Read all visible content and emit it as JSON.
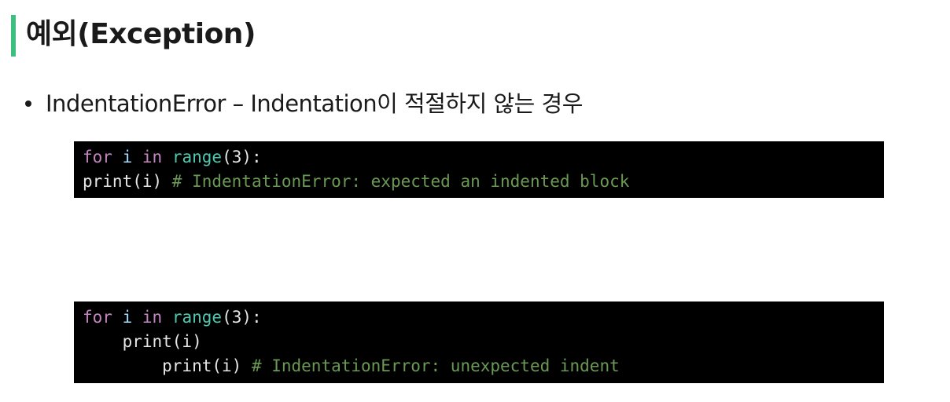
{
  "slide": {
    "title": "예외(Exception)",
    "bullet": "IndentationError – Indentation이 적절하지 않는 경우"
  },
  "colors": {
    "accent": "#3fbf7f",
    "code_bg": "#000000",
    "keyword": "#c586c0",
    "variable": "#9cdcfe",
    "function": "#4ec9b0",
    "comment": "#6a9955",
    "plain": "#e6e6e6"
  },
  "code_blocks": [
    {
      "lines": [
        [
          {
            "t": "for",
            "c": "kw"
          },
          {
            "t": " ",
            "c": "pl"
          },
          {
            "t": "i",
            "c": "var"
          },
          {
            "t": " ",
            "c": "pl"
          },
          {
            "t": "in",
            "c": "kw"
          },
          {
            "t": " ",
            "c": "pl"
          },
          {
            "t": "range",
            "c": "fn"
          },
          {
            "t": "(3):",
            "c": "pl"
          }
        ],
        [
          {
            "t": "print",
            "c": "pl"
          },
          {
            "t": "(i) ",
            "c": "pl"
          },
          {
            "t": "# IndentationError: expected an indented block",
            "c": "cm"
          }
        ]
      ]
    },
    {
      "lines": [
        [
          {
            "t": "for",
            "c": "kw"
          },
          {
            "t": " ",
            "c": "pl"
          },
          {
            "t": "i",
            "c": "var"
          },
          {
            "t": " ",
            "c": "pl"
          },
          {
            "t": "in",
            "c": "kw"
          },
          {
            "t": " ",
            "c": "pl"
          },
          {
            "t": "range",
            "c": "fn"
          },
          {
            "t": "(3):",
            "c": "pl"
          }
        ],
        [
          {
            "t": "    print(i)",
            "c": "pl"
          }
        ],
        [
          {
            "t": "        print(i) ",
            "c": "pl"
          },
          {
            "t": "# IndentationError: unexpected indent",
            "c": "cm"
          }
        ]
      ]
    }
  ]
}
